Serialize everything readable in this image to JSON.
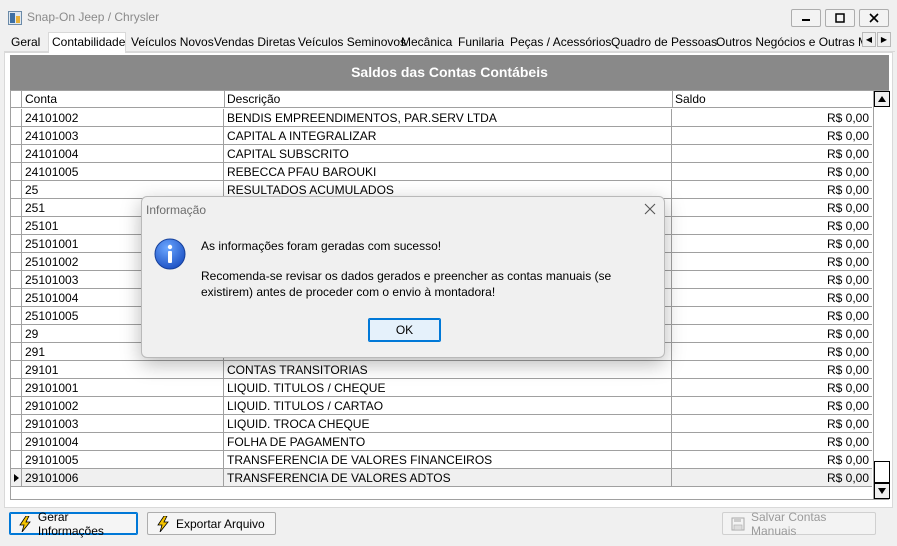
{
  "window": {
    "title": "Snap-On Jeep / Chrysler",
    "controls": [
      "minimize-icon",
      "maximize-icon",
      "close-icon"
    ]
  },
  "tabs": [
    {
      "label": "Geral",
      "active": false
    },
    {
      "label": "Contabilidade",
      "active": true
    },
    {
      "label": "Veículos Novos",
      "active": false
    },
    {
      "label": "Vendas Diretas",
      "active": false
    },
    {
      "label": "Veículos Seminovos",
      "active": false
    },
    {
      "label": "Mecânica",
      "active": false
    },
    {
      "label": "Funilaria",
      "active": false
    },
    {
      "label": "Peças / Acessórios",
      "active": false
    },
    {
      "label": "Quadro de Pessoas",
      "active": false
    },
    {
      "label": "Outros Negócios e Outras Mar",
      "active": false
    }
  ],
  "grid": {
    "title": "Saldos das Contas Contábeis",
    "columns": [
      "Conta",
      "Descrição",
      "Saldo"
    ],
    "rows": [
      {
        "conta": "24101002",
        "descricao": "BENDIS EMPREENDIMENTOS, PAR.SERV LTDA",
        "saldo": "R$ 0,00"
      },
      {
        "conta": "24101003",
        "descricao": "CAPITAL A INTEGRALIZAR",
        "saldo": "R$ 0,00"
      },
      {
        "conta": "24101004",
        "descricao": "CAPITAL SUBSCRITO",
        "saldo": "R$ 0,00"
      },
      {
        "conta": "24101005",
        "descricao": "REBECCA PFAU BAROUKI",
        "saldo": "R$ 0,00"
      },
      {
        "conta": "25",
        "descricao": "RESULTADOS ACUMULADOS",
        "saldo": "R$ 0,00"
      },
      {
        "conta": "251",
        "descricao": "",
        "saldo": "R$ 0,00"
      },
      {
        "conta": "25101",
        "descricao": "",
        "saldo": "R$ 0,00"
      },
      {
        "conta": "25101001",
        "descricao": "",
        "saldo": "R$ 0,00"
      },
      {
        "conta": "25101002",
        "descricao": "",
        "saldo": "R$ 0,00"
      },
      {
        "conta": "25101003",
        "descricao": "",
        "saldo": "R$ 0,00"
      },
      {
        "conta": "25101004",
        "descricao": "",
        "saldo": "R$ 0,00"
      },
      {
        "conta": "25101005",
        "descricao": "",
        "saldo": "R$ 0,00"
      },
      {
        "conta": "29",
        "descricao": "",
        "saldo": "R$ 0,00"
      },
      {
        "conta": "291",
        "descricao": "",
        "saldo": "R$ 0,00"
      },
      {
        "conta": "29101",
        "descricao": "CONTAS TRANSITORIAS",
        "saldo": "R$ 0,00"
      },
      {
        "conta": "29101001",
        "descricao": "LIQUID. TITULOS / CHEQUE",
        "saldo": "R$ 0,00"
      },
      {
        "conta": "29101002",
        "descricao": "LIQUID. TITULOS / CARTAO",
        "saldo": "R$ 0,00"
      },
      {
        "conta": "29101003",
        "descricao": "LIQUID. TROCA CHEQUE",
        "saldo": "R$ 0,00"
      },
      {
        "conta": "29101004",
        "descricao": "FOLHA DE PAGAMENTO",
        "saldo": "R$ 0,00"
      },
      {
        "conta": "29101005",
        "descricao": "TRANSFERENCIA DE VALORES FINANCEIROS",
        "saldo": "R$ 0,00"
      },
      {
        "conta": "29101006",
        "descricao": "TRANSFERENCIA DE VALORES ADTOS",
        "saldo": "R$ 0,00",
        "selected": true
      }
    ]
  },
  "buttons": {
    "gerar": "Gerar Informações",
    "exportar": "Exportar Arquivo",
    "salvar": "Salvar Contas Manuais"
  },
  "dialog": {
    "title": "Informação",
    "message1": "As informações foram geradas com sucesso!",
    "message2": "Recomenda-se revisar os dados gerados e preencher as contas manuais (se existirem) antes de proceder com o envio à montadora!",
    "ok_label": "OK",
    "icon": "info-icon"
  },
  "colors": {
    "grid_title_bg": "#898989",
    "accent": "#0078d7"
  }
}
